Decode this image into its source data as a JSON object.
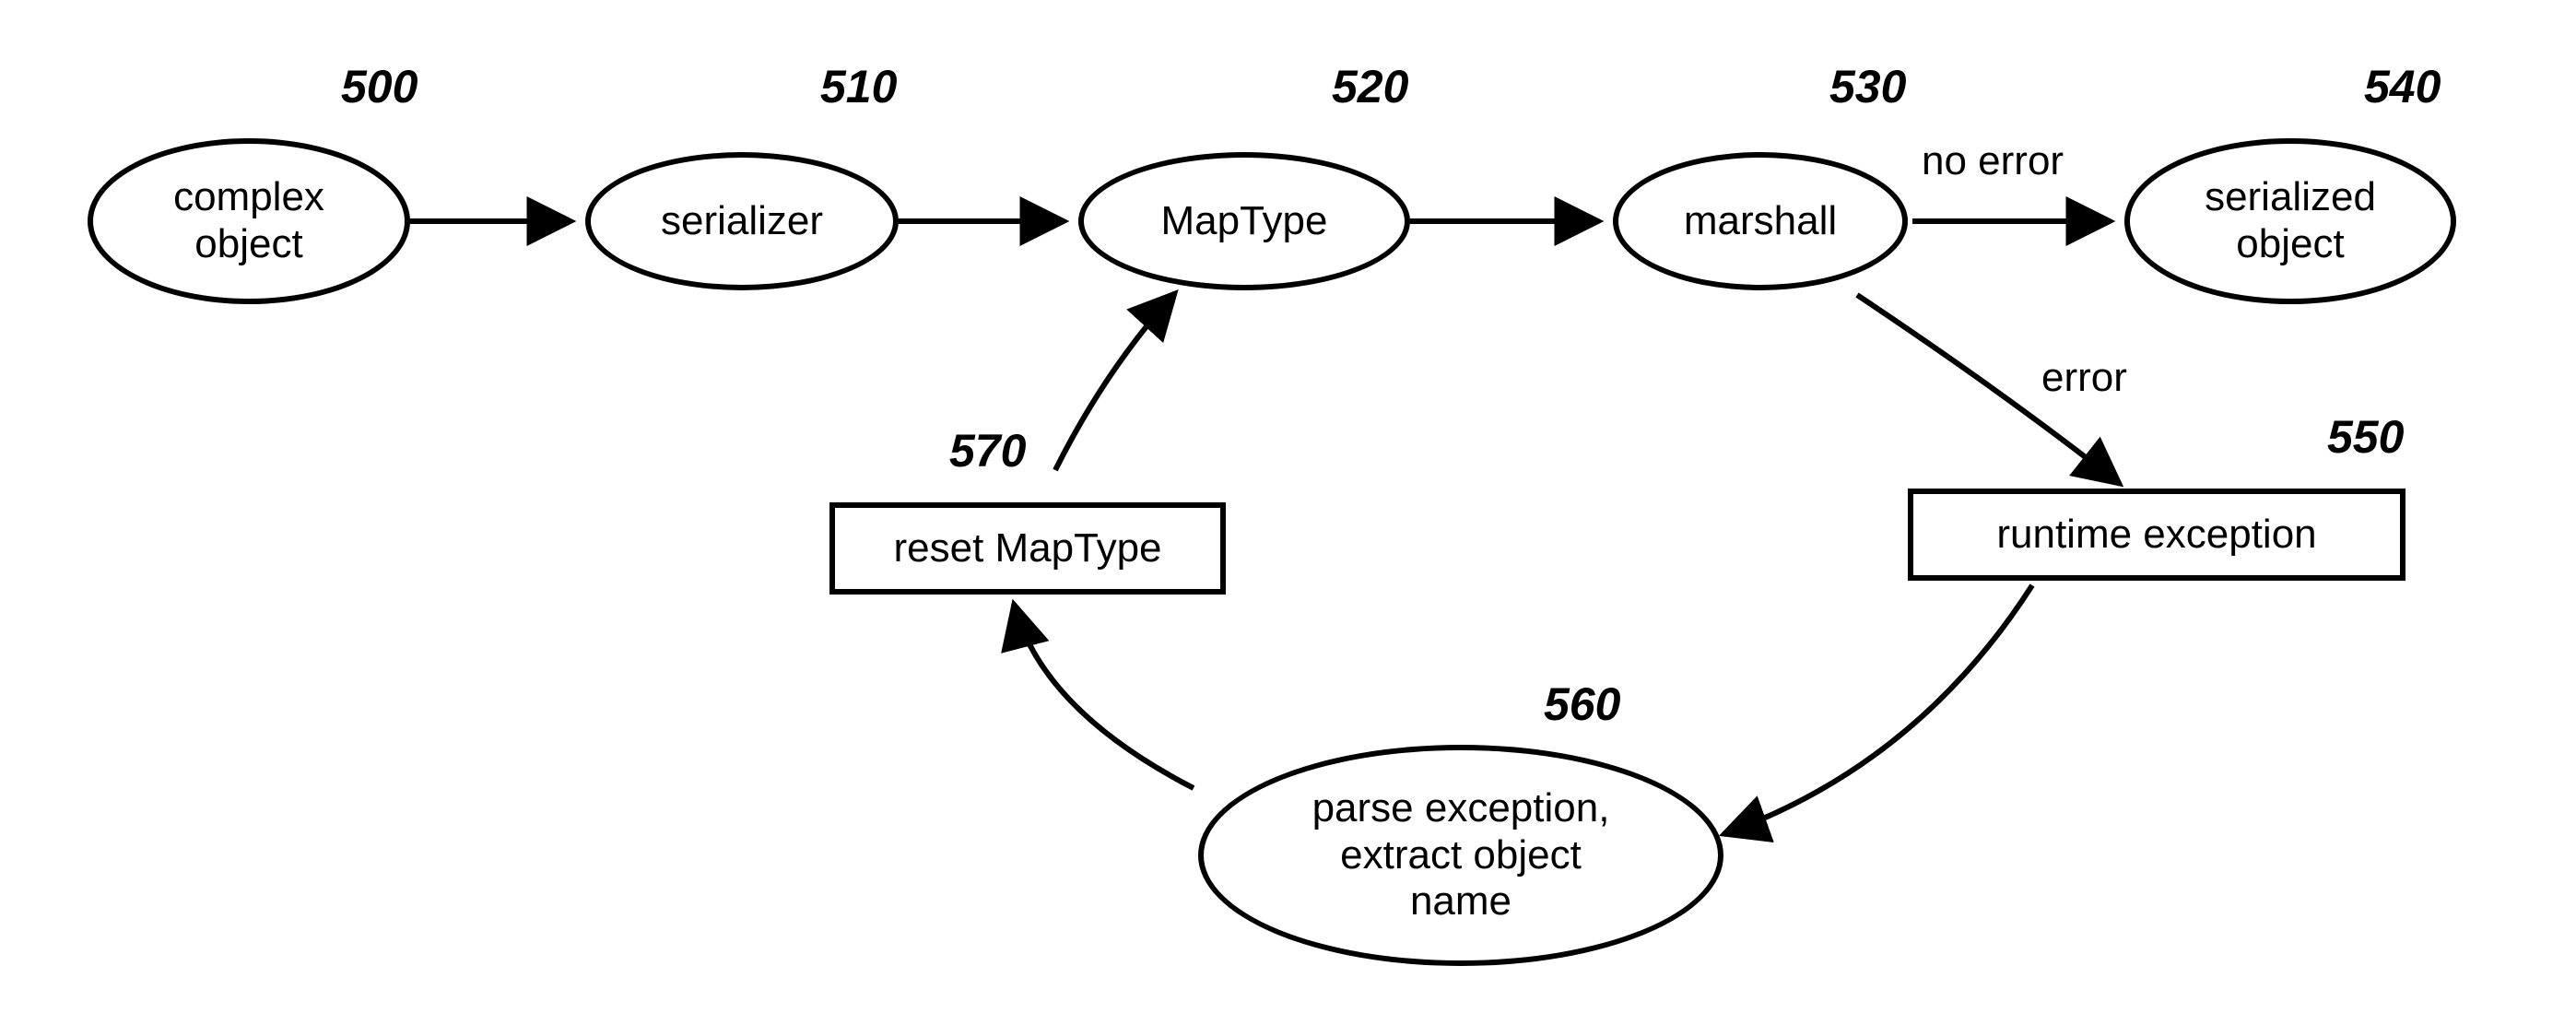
{
  "nodes": {
    "n500": {
      "ref": "500",
      "label": "complex\nobject"
    },
    "n510": {
      "ref": "510",
      "label": "serializer"
    },
    "n520": {
      "ref": "520",
      "label": "MapType"
    },
    "n530": {
      "ref": "530",
      "label": "marshall"
    },
    "n540": {
      "ref": "540",
      "label": "serialized\nobject"
    },
    "n550": {
      "ref": "550",
      "label": "runtime exception"
    },
    "n560": {
      "ref": "560",
      "label": "parse exception,\nextract object\nname"
    },
    "n570": {
      "ref": "570",
      "label": "reset MapType"
    }
  },
  "edges": {
    "noerror": "no error",
    "error": "error"
  }
}
